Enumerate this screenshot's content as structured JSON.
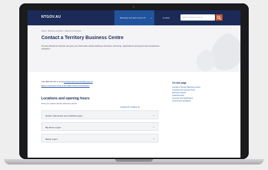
{
  "header": {
    "brand": "NTGOV.AU",
    "active_tab": "Business and jobs in the NT",
    "contact": "Contact",
    "search_placeholder": "Search business.nt.gov.au"
  },
  "breadcrumb": "Home > Business and jobs > Support for business",
  "page": {
    "title": "Contact a Territory Business Centre",
    "intro": "Territory Business Centres can give you information about starting a business, licensing, registrations and government assistance programs."
  },
  "contact": {
    "phone_line": "Call 1800 193 111 or email",
    "email": "territorybusinesscentres@nt.gov.au",
    "helper": "Report a business crime to the Office of the Commissioner."
  },
  "locations": {
    "title": "Locations and opening hours",
    "subtitle": "Find your nearest Territory Business Centre.",
    "expand_all": "Expand all",
    "collapse_all": "Collapse all",
    "items": [
      "Darwin, Palmerston and Litchfield region",
      "Big Rivers region",
      "Barkly region"
    ]
  },
  "sidebar": {
    "heading": "On this page",
    "links": [
      "Contact a Territory Business Centre",
      "Locations and opening hours",
      "Business support",
      "Small business",
      "Licences and registrations",
      "Government assistance"
    ]
  },
  "colors": {
    "navy": "#1b2a57",
    "blue": "#20539c",
    "orange": "#c8582e"
  }
}
